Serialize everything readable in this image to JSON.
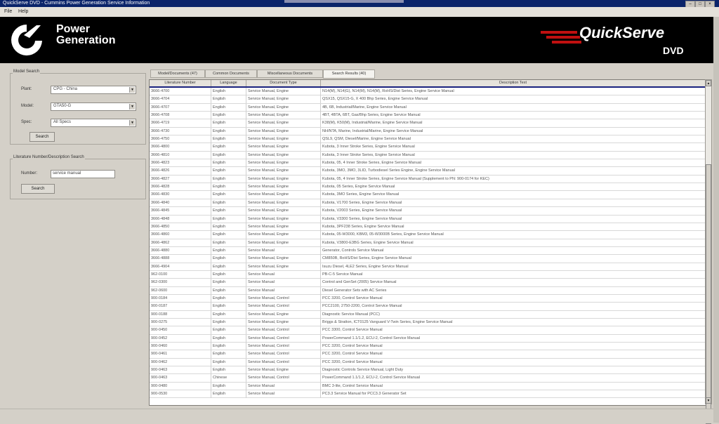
{
  "window": {
    "title": "QuickServe DVD - Cummins Power Generation Service Information"
  },
  "menu": [
    "File",
    "Help"
  ],
  "brand": {
    "line1": "Power",
    "line2": "Generation",
    "product": "QuickServe",
    "product_suffix": "DVD"
  },
  "model_search": {
    "title": "Model Search",
    "fields": [
      {
        "label": "Plant:",
        "value": "CPG - China"
      },
      {
        "label": "Model:",
        "value": "GTA50-G"
      },
      {
        "label": "Spec:",
        "value": "All Specs"
      }
    ],
    "search_label": "Search"
  },
  "literature_search": {
    "title": "Literature Number/Description Search",
    "number_label": "Number:",
    "number_value": "service manual",
    "search_label": "Search"
  },
  "tabs": [
    "Model/Documents (47)",
    "Common Documents",
    "Miscellaneous Documents",
    "Search Results (40)"
  ],
  "table": {
    "columns": [
      "Literature Number",
      "Language",
      "Document Type",
      "Description Text"
    ],
    "rows": [
      [
        "3666-4700",
        "English",
        "Service Manual, Engine",
        "N14(M), N14(G), N14(M), N14(M), RoHS/Dist Series, Engine Service Manual"
      ],
      [
        "3666-4704",
        "English",
        "Service Manual, Engine",
        "QSX15, QSX15-G, X 400 Bhp Series, Engine Service Manual"
      ],
      [
        "3666-4707",
        "English",
        "Service Manual, Engine",
        "4B, 6B, Industrial/Marine, Engine Service Manual"
      ],
      [
        "3666-4708",
        "English",
        "Service Manual, Engine",
        "4BT, 4BTA, 6BT, Gas/Bhp Series, Engine Service Manual"
      ],
      [
        "3666-4719",
        "English",
        "Service Manual, Engine",
        "K38(M), K50(M), Industrial/Marine, Engine Service Manual"
      ],
      [
        "3666-4730",
        "English",
        "Service Manual, Engine",
        "NH/NTA, Marine, Industrial/Marine, Engine Service Manual"
      ],
      [
        "3666-4750",
        "English",
        "Service Manual, Engine",
        "QSL9, QSM, Diesel/Marine, Engine Service Manual"
      ],
      [
        "3666-4800",
        "English",
        "Service Manual, Engine",
        "Kubota, 3 Inner Stroke Series, Engine Service Manual"
      ],
      [
        "3666-4810",
        "English",
        "Service Manual, Engine",
        "Kubota, 3 Inner Stroke Series, Engine Service Manual"
      ],
      [
        "3666-4823",
        "English",
        "Service Manual, Engine",
        "Kubota, 05, 4 Inner Stroke Series, Engine Service Manual"
      ],
      [
        "3666-4826",
        "English",
        "Service Manual, Engine",
        "Kubota, 3MO, 3MO, 3LID, Turbodiesel Series Engine, Engine Service Manual"
      ],
      [
        "3666-4827",
        "English",
        "Service Manual, Engine",
        "Kubota, 05, 4 Inner Stroke Series, Engine Service Manual (Supplement to PN: 900-0174 for KEC)"
      ],
      [
        "3666-4828",
        "English",
        "Service Manual, Engine",
        "Kubota, 05 Series, Engine Service Manual"
      ],
      [
        "3666-4830",
        "English",
        "Service Manual, Engine",
        "Kubota, 3MO Series, Engine Service Manual"
      ],
      [
        "3666-4840",
        "English",
        "Service Manual, Engine",
        "Kubota, V1700 Series, Engine Service Manual"
      ],
      [
        "3666-4845",
        "English",
        "Service Manual, Engine",
        "Kubota, V2003 Series, Engine Service Manual"
      ],
      [
        "3666-4848",
        "English",
        "Service Manual, Engine",
        "Kubota, V3300 Series, Engine Service Manual"
      ],
      [
        "3666-4850",
        "English",
        "Service Manual, Engine",
        "Kubota, 3PF238 Series, Engine Service Manual"
      ],
      [
        "3666-4860",
        "English",
        "Service Manual, Engine",
        "Kubota, 05-W3000, KBM3, 05-W3000B Series, Engine Service Manual"
      ],
      [
        "3666-4862",
        "English",
        "Service Manual, Engine",
        "Kubota, V3800-E3BG Series, Engine Service Manual"
      ],
      [
        "3666-4880",
        "English",
        "Service Manual",
        "Generator, Controls Service Manual"
      ],
      [
        "3666-4888",
        "English",
        "Service Manual, Engine",
        "CM850B, RoHS/Dist Series, Engine Service Manual"
      ],
      [
        "3666-4904",
        "English",
        "Service Manual, Engine",
        "Isuzu Diesel, 4LE2 Series, Engine Service Manual"
      ],
      [
        "962-0100",
        "English",
        "Service Manual",
        "PB-C-5 Service Manual"
      ],
      [
        "962-0300",
        "English",
        "Service Manual",
        "Control and GenSet (2005) Service Manual"
      ],
      [
        "962-0600",
        "English",
        "Service Manual",
        "Diesel Generator Sets with AC Series"
      ],
      [
        "900-0184",
        "English",
        "Service Manual, Control",
        "PCC 3200, Control Service Manual"
      ],
      [
        "900-0187",
        "English",
        "Service Manual, Control",
        "PCC2100, 2750-2200, Control Service Manual"
      ],
      [
        "900-0188",
        "English",
        "Service Manual, Engine",
        "Diagnostic Service Manual (PCC)"
      ],
      [
        "900-0275",
        "English",
        "Service Manual, Engine",
        "Briggs & Stratton, ICT0125 Vanguard V-Twin Series, Engine Service Manual"
      ],
      [
        "900-0450",
        "English",
        "Service Manual, Control",
        "PCC 3300, Control Service Manual"
      ],
      [
        "900-0452",
        "English",
        "Service Manual, Control",
        "PowerCommand 1.1/1.2, ECU-2, Control Service Manual"
      ],
      [
        "900-0460",
        "English",
        "Service Manual, Control",
        "PCC 3200, Control Service Manual"
      ],
      [
        "900-0461",
        "English",
        "Service Manual, Control",
        "PCC 3200, Control Service Manual"
      ],
      [
        "900-0462",
        "English",
        "Service Manual, Control",
        "PCC 3200, Control Service Manual"
      ],
      [
        "900-0463",
        "English",
        "Service Manual, Engine",
        "Diagnostic Controls Service Manual, Light Duty"
      ],
      [
        "900-0463",
        "Chinese",
        "Service Manual, Control",
        "PowerCommand 1.1/1.2, ECU-2, Control Service Manual"
      ],
      [
        "900-0480",
        "English",
        "Service Manual",
        "BMC 3-lite, Control Service Manual"
      ],
      [
        "900-0530",
        "English",
        "Service Manual",
        "PC3.3 Service Manual for PCC3.3 Generator Set"
      ]
    ]
  }
}
